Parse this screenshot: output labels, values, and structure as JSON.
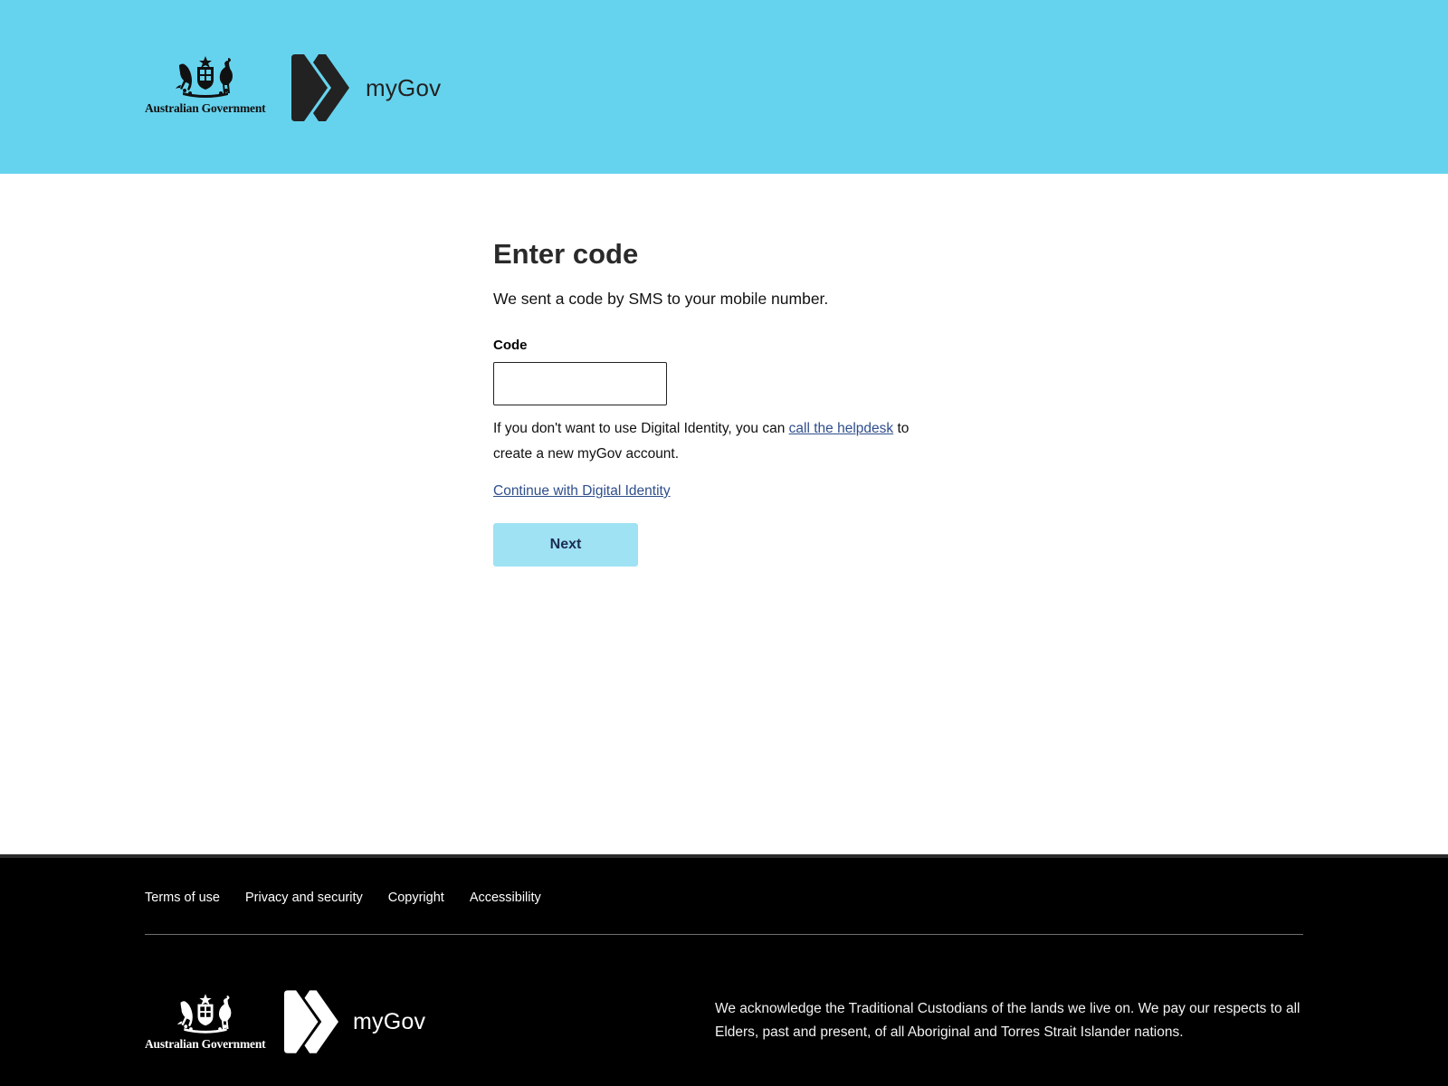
{
  "header": {
    "gov_name": "Australian Government",
    "brand": "myGov"
  },
  "main": {
    "title": "Enter code",
    "intro": "We sent a code by SMS to your mobile number.",
    "code_label": "Code",
    "code_value": "",
    "help_prefix": "If you don't want to use Digital Identity, you can",
    "help_link": "call the helpdesk",
    "help_suffix": "to create a new myGov account.",
    "continue_link": "Continue with Digital Identity",
    "next_button": "Next"
  },
  "footer": {
    "links": [
      "Terms of use",
      "Privacy and security",
      "Copyright",
      "Accessibility"
    ],
    "gov_name": "Australian Government",
    "brand": "myGov",
    "acknowledgement": "We acknowledge the Traditional Custodians of the lands we live on. We pay our respects to all Elders, past and present, of all Aboriginal and Torres Strait Islander nations."
  },
  "colors": {
    "header_bg": "#66d3ee",
    "link": "#2f4e8c",
    "button_bg": "#9fe2f3",
    "footer_bg": "#000000"
  },
  "icons": {
    "crest": "australian-coat-of-arms-icon",
    "brand_mark": "mygov-chevron-icon"
  }
}
